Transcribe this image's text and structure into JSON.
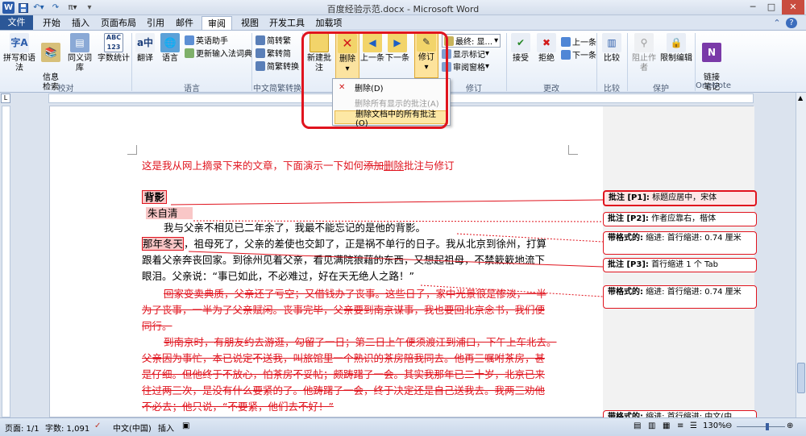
{
  "window": {
    "title": "百度经验示范.docx - Microsoft Word",
    "minimize": "─",
    "maximize": "□",
    "close": "✕"
  },
  "qat": {
    "undo": "↶▾",
    "redo": "↷",
    "pi": "π▾",
    "customize": "▾"
  },
  "tabs": {
    "file": "文件",
    "items": [
      "开始",
      "插入",
      "页面布局",
      "引用",
      "邮件",
      "审阅",
      "视图",
      "开发工具",
      "加载项"
    ],
    "active": "审阅"
  },
  "ribbon": {
    "proofing": {
      "spell": "拼写和语法",
      "info": "信息\n检索",
      "thesaurus": "同义词库",
      "wordcount": "字数统计",
      "label": "校对"
    },
    "language": {
      "translate": "翻译",
      "language": "语言",
      "assistant": "英语助手",
      "update_ime": "更新输入法词典",
      "label": "语言"
    },
    "chinese": {
      "to_trad": "简转繁",
      "to_simp": "繁转简",
      "convert": "简繁转换",
      "label": "中文简繁转换"
    },
    "comments": {
      "new": "新建批注",
      "delete": "删除",
      "prev": "上一条",
      "next": "下一条",
      "track": "修订"
    },
    "tracking": {
      "final": "最终: 显...",
      "show_markup": "显示标记",
      "review_pane": "审阅窗格",
      "label": "修订"
    },
    "changes": {
      "accept": "接受",
      "reject": "拒绝",
      "prev": "上一条",
      "next": "下一条",
      "label": "更改"
    },
    "compare": {
      "compare": "比较",
      "label": "比较"
    },
    "protect": {
      "block_authors": "阻止作者",
      "restrict": "限制编辑",
      "label": "保护"
    },
    "onenote": {
      "linked_notes": "链接\n笔记",
      "label": "OneNote"
    }
  },
  "dropdown": {
    "items": [
      {
        "label": "删除(D)",
        "disabled": false,
        "highlight": false
      },
      {
        "label": "删除所有显示的批注(A)",
        "disabled": true,
        "highlight": false
      },
      {
        "label": "删除文档中的所有批注(O)",
        "disabled": false,
        "highlight": true
      }
    ]
  },
  "document": {
    "l1a": "这是我从网上摘录下来的文章，下面演示一下如何",
    "l1b": "添加",
    "l1c": "删除",
    "l1d": "批注与修订",
    "title": "背影",
    "author": "朱自清",
    "p1": "我与父亲不相见已二年余了，我最不能忘记的是他的背影。",
    "p2a": "那年冬天",
    "p2b": "，祖母死了，父亲的差使也交卸了，正是祸不单行的日子。我从北京到徐州，打算",
    "p2c": "跟着父亲奔丧回家。到徐州见着父亲，看见满院狼藉的东西，又想起祖母，不禁簌簌地流下",
    "p2d": "眼泪。父亲说：“事已如此，不必难过，好在天无绝人之路！”",
    "d1": "回家变卖典质，父亲还了亏空；又借钱办了丧事。这些日子，家中光景很是惨淡，一半",
    "d2": "为了丧事，一半为了父亲赋闲。丧事完毕，父亲要到南京谋事，我也要回北京念书，我们便",
    "d3": "同行。",
    "d4": "到南京时，有朋友约去游逛，勾留了一日；第二日上午便须渡江到浦口，下午上车北去。",
    "d5": "父亲因为事忙，本已说定不送我，叫旅馆里一个熟识的茶房陪我同去。他再三嘱咐茶房，甚",
    "d6": "是仔细。但他终于不放心，怕茶房不妥帖；颇踌躇了一会。其实我那年已二十岁，北京已来",
    "d7": "往过两三次，是没有什么要紧的了。他踌躇了一会，终于决定还是自己送我去。我两三劝他",
    "d8": "不必去；他只说，“不要紧，他们去不好！”"
  },
  "balloons": [
    {
      "head": "批注 [P1]:",
      "text": " 标题应居中，宋体"
    },
    {
      "head": "批注 [P2]:",
      "text": " 作者应靠右，楷体"
    },
    {
      "head": "带格式的:",
      "text": " 缩进: 首行缩进:  0.74 厘米"
    },
    {
      "head": "批注 [P3]:",
      "text": " 首行缩进 1 个 Tab"
    },
    {
      "head": "带格式的:",
      "text": " 缩进: 首行缩进:  0.74 厘米"
    },
    {
      "head": "带格式的:",
      "text": " 缩进: 首行缩进: 中文(中"
    }
  ],
  "status": {
    "page": "页面: 1/1",
    "words": "字数: 1,091",
    "lang": "中文(中国)",
    "mode": "插入",
    "zoom": "130%"
  }
}
